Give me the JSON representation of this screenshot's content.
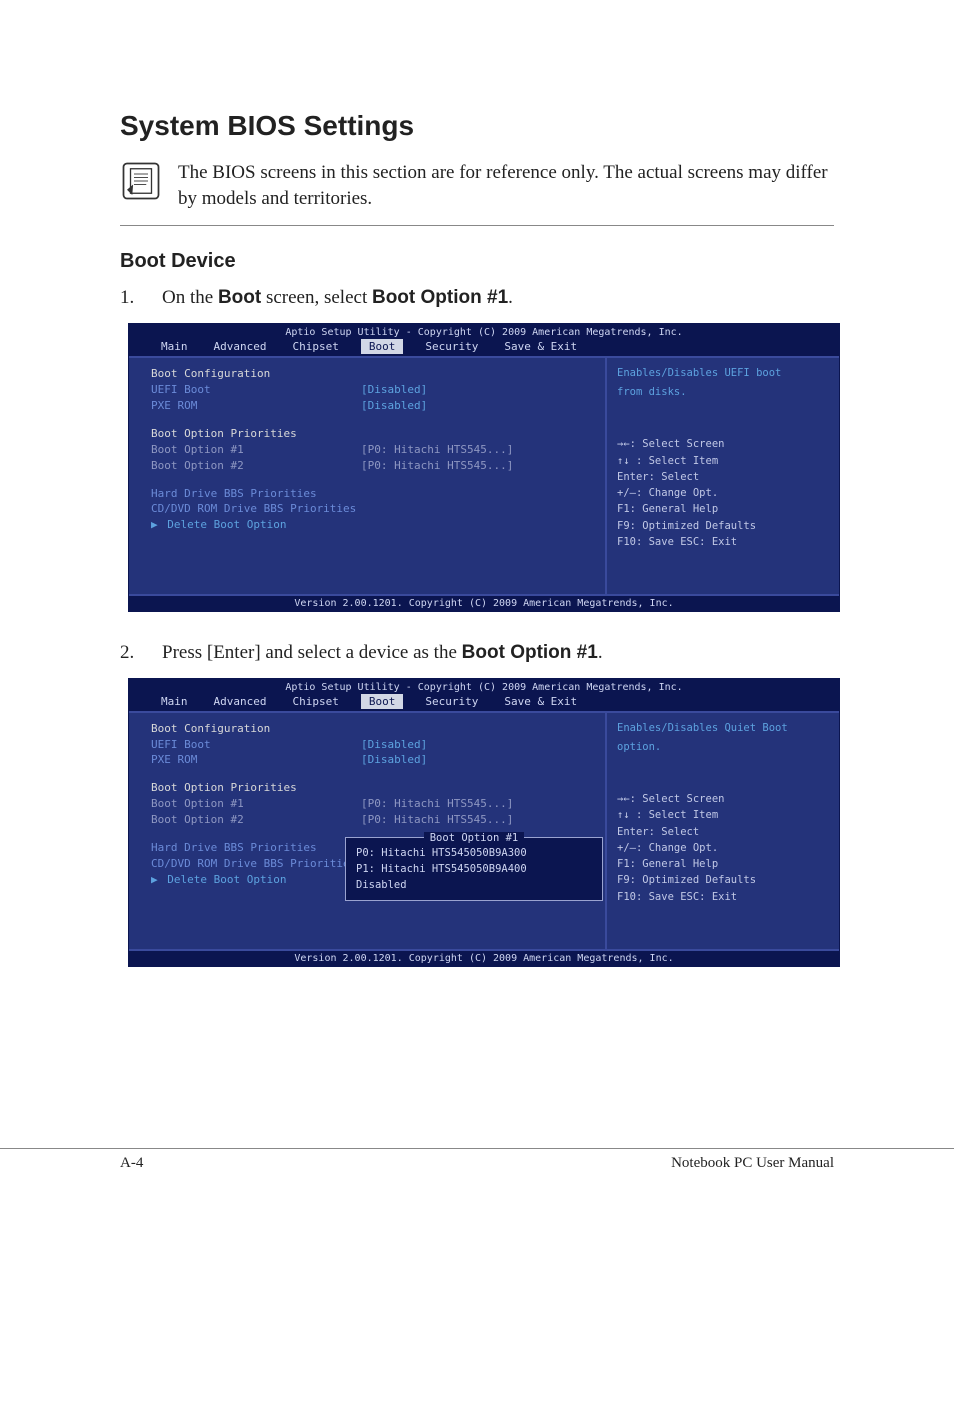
{
  "heading": "System BIOS Settings",
  "note": "The BIOS screens in this section are for reference only. The actual screens may differ by models and territories.",
  "subheading": "Boot Device",
  "step1": {
    "num": "1.",
    "pre": "On the ",
    "b1": "Boot",
    "mid": " screen, select ",
    "b2": "Boot Option #1",
    "post": "."
  },
  "step2": {
    "num": "2.",
    "pre": "Press [Enter] and select a device as the ",
    "b1": "Boot Option #1",
    "post": "."
  },
  "bios_common": {
    "header": "Aptio Setup Utility - Copyright (C) 2009 American Megatrends, Inc.",
    "tabs": [
      "Main",
      "Advanced",
      "Chipset",
      "Boot",
      "Security",
      "Save & Exit"
    ],
    "footer": "Version 2.00.1201. Copyright (C) 2009 American Megatrends, Inc.",
    "left": {
      "boot_config": "Boot Configuration",
      "uefi_label": "UEFI Boot",
      "uefi_val": "[Disabled]",
      "pxe_label": "PXE ROM",
      "pxe_val": "[Disabled]",
      "prio": "Boot Option Priorities",
      "opt1_label": "Boot Option #1",
      "opt1_val": "[P0: Hitachi HTS545...]",
      "opt2_label": "Boot Option #2",
      "opt2_val": "[P0: Hitachi HTS545...]",
      "hdd": "Hard Drive BBS Priorities",
      "cddvd": "CD/DVD ROM Drive BBS Priorities",
      "delete_arrow": "▶",
      "delete": "Delete Boot Option"
    },
    "nav": {
      "l1": "→←: Select Screen",
      "l2": "↑↓ :  Select Item",
      "l3": "Enter: Select",
      "l4": "+/—:  Change Opt.",
      "l5": "F1:   General Help",
      "l6": "F9:   Optimized Defaults",
      "l7": "F10:  Save   ESC: Exit"
    }
  },
  "bios1_help": {
    "line1": "Enables/Disables UEFI boot",
    "line2": "from disks."
  },
  "bios2_help": {
    "line1": "Enables/Disables Quiet Boot",
    "line2": "option."
  },
  "bios2_popup": {
    "title": "Boot Option #1",
    "opt1": "P0: Hitachi HTS545050B9A300",
    "opt2": "P1: Hitachi HTS545050B9A400",
    "opt3": "Disabled"
  },
  "footer_left": "A-4",
  "footer_right": "Notebook PC User Manual"
}
